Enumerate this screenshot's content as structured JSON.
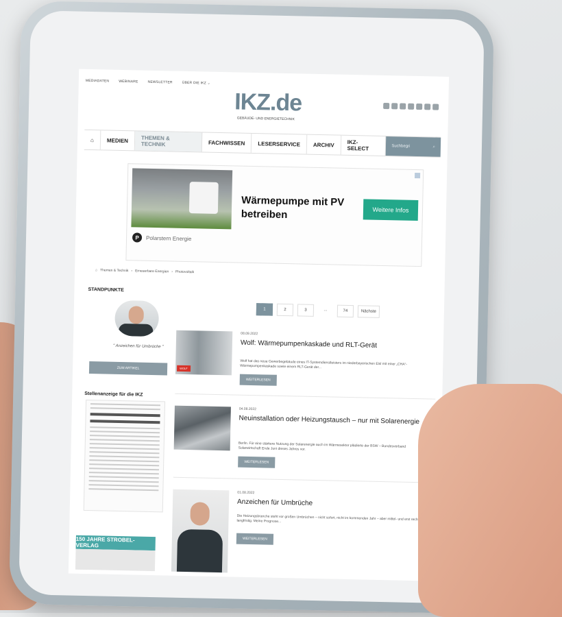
{
  "topnav": [
    "MEDIADATEN",
    "WEBINARE",
    "NEWSLETTER",
    "ÜBER DIE IKZ ⌄"
  ],
  "logo": {
    "name": "IKZ.de",
    "tagline": "GEBÄUDE- UND ENERGIETECHNIK"
  },
  "mainnav": {
    "items": [
      "MEDIEN",
      "THEMEN & TECHNIK",
      "FACHWISSEN",
      "LESERSERVICE",
      "ARCHIV",
      "IKZ-SELECT"
    ],
    "search_label": "Suchbegri"
  },
  "ad": {
    "title": "Wärmepumpe mit PV betreiben",
    "button": "Weitere Infos",
    "brand_initial": "P",
    "brand": "Polarstern Energie"
  },
  "breadcrumb": [
    "Themen & Technik",
    "Erneuerbare Energien",
    "Photovoltaik"
  ],
  "sidebar": {
    "standpunkte_title": "STANDPUNKTE",
    "quote": "\" Anzeichen für Umbrüche \"",
    "article_button": "ZUM ARTIKEL",
    "job_title": "Stellenanzeige für die IKZ",
    "banner": "150 JAHRE STROBEL-VERLAG"
  },
  "pagination": [
    "1",
    "2",
    "3",
    "...",
    "74",
    "Nächste"
  ],
  "articles": [
    {
      "date": "08.09.2022",
      "title": "Wolf: Wärmepumpenkaskade und RLT-Gerät",
      "teaser": "Wolf hat das neue Gewerbegebäude eines IT-Systemdienstleisters im niederbayerischen Eisl mit einer „CHA“-Wärmepumpenkaskade sowie einem RLT-Gerät der...",
      "button": "WEITERLESEN",
      "badge": "WOLF"
    },
    {
      "date": "04.08.2022",
      "title": "Neuinstallation oder Heizungstausch – nur mit Solarenergie",
      "teaser": "Berlin. Für eine stärkere Nutzung der Solarenergie auch im Wärmesektor plädierte der BSW – Bundesverband Solarwirtschaft Ende Juni dieses Jahres vor.",
      "button": "WEITERLESEN"
    },
    {
      "date": "01.08.2022",
      "title": "Anzeichen für Umbrüche",
      "teaser": "Die Heizungsbranche steht vor großen Umbrüchen – nicht sofort, nicht im kommenden Jahr – aber mittel- und erst recht langfristig. Meine Prognose...",
      "button": "WEITERLESEN"
    }
  ]
}
